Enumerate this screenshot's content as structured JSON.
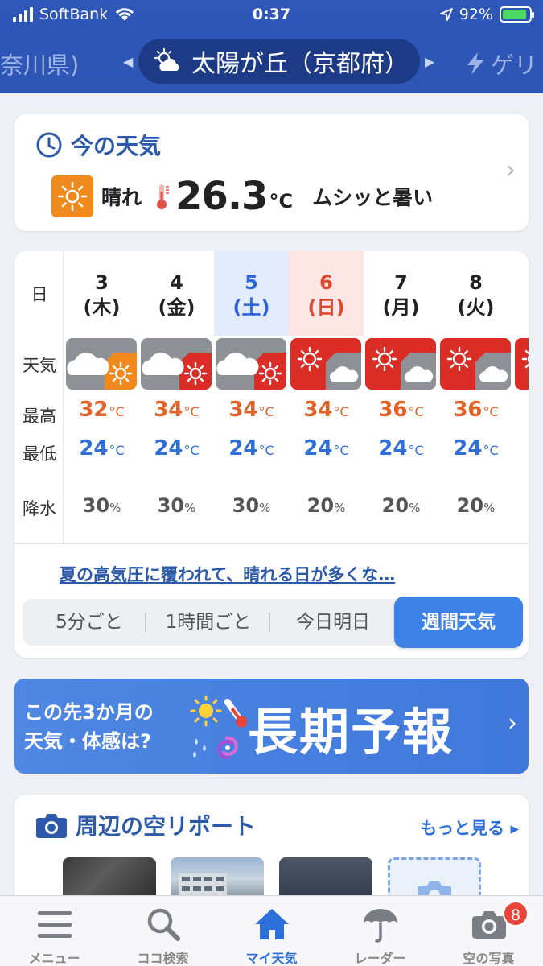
{
  "status_bar": {
    "carrier": "SoftBank",
    "time": "0:37",
    "battery_percent": "92%",
    "battery_level": 0.92,
    "icons": [
      "signal-icon",
      "wifi-icon",
      "location-arrow-icon",
      "battery-icon"
    ]
  },
  "location_bar": {
    "prev_location": "奈川県)",
    "current_location": "太陽が丘（京都府）",
    "next_location": "ゲリ",
    "current_icon": "partly-cloudy-icon",
    "next_icon": "lightning-icon"
  },
  "current_weather": {
    "title": "今の天気",
    "condition": "晴れ",
    "temperature": "26.3",
    "temp_unit": "°C",
    "feel": "ムシッと暑い",
    "icons": [
      "clock-icon",
      "sun-icon",
      "thermometer-icon",
      "chevron-right-icon"
    ]
  },
  "weekly": {
    "row_labels": {
      "day": "日",
      "weather": "天気",
      "high": "最高",
      "low": "最低",
      "precip": "降水"
    },
    "temp_unit": "°C",
    "precip_unit": "%",
    "days": [
      {
        "date": "3",
        "weekday": "(木)",
        "high": "32",
        "low": "24",
        "precip": "30",
        "weather": "cloudy-then-sunny"
      },
      {
        "date": "4",
        "weekday": "(金)",
        "high": "34",
        "low": "24",
        "precip": "30",
        "weather": "cloudy-then-hot"
      },
      {
        "date": "5",
        "weekday": "(土)",
        "high": "34",
        "low": "24",
        "precip": "30",
        "weather": "cloudy-then-hot"
      },
      {
        "date": "6",
        "weekday": "(日)",
        "high": "34",
        "low": "24",
        "precip": "20",
        "weather": "hot-then-cloudy"
      },
      {
        "date": "7",
        "weekday": "(月)",
        "high": "36",
        "low": "24",
        "precip": "20",
        "weather": "hot-then-cloudy"
      },
      {
        "date": "8",
        "weekday": "(火)",
        "high": "36",
        "low": "24",
        "precip": "20",
        "weather": "hot-then-cloudy"
      }
    ],
    "summary": "夏の高気圧に覆われて、晴れる日が多くな…",
    "tabs": [
      "5分ごと",
      "1時間ごと",
      "今日明日",
      "週間天気"
    ],
    "active_tab": "週間天気"
  },
  "banner": {
    "line1": "この先3か月の",
    "line2": "天気・体感は?",
    "main": "長期予報",
    "icons": [
      "sun-icon",
      "thermometer-icon",
      "rain-icon",
      "typhoon-icon",
      "chevron-right-icon"
    ]
  },
  "sky_report": {
    "title": "周辺の空リポート",
    "more": "もっと見る ▸",
    "icons": [
      "camera-icon"
    ]
  },
  "tabbar": {
    "tabs": [
      {
        "label": "メニュー",
        "icon": "menu-icon"
      },
      {
        "label": "ココ検索",
        "icon": "search-icon"
      },
      {
        "label": "マイ天気",
        "icon": "home-icon"
      },
      {
        "label": "レーダー",
        "icon": "umbrella-icon"
      },
      {
        "label": "空の写真",
        "icon": "camera-icon"
      }
    ],
    "active": "マイ天気",
    "photo_badge": "8"
  },
  "colors": {
    "header": "#2c55b4",
    "high_temp": "#e0642a",
    "low_temp": "#2f6fd6",
    "saturday": "#2d65d8",
    "sunday": "#e04832",
    "accent": "#3e82e8",
    "sunny_orange": "#f18a1c",
    "hot_red": "#d92d25"
  }
}
